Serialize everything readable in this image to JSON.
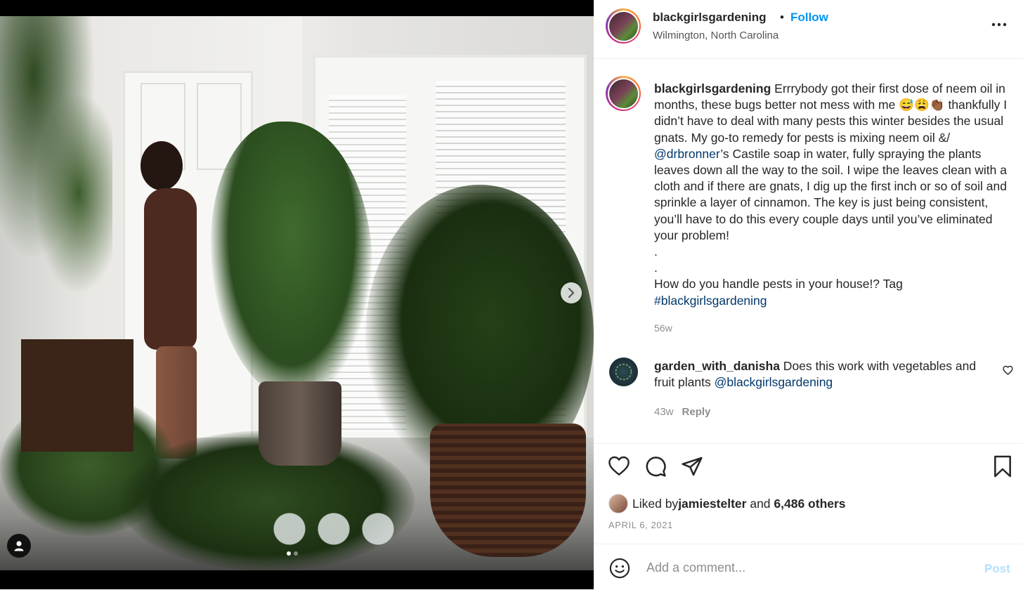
{
  "post": {
    "carousel": {
      "slide_count": 2,
      "active_slide": 1
    },
    "next_icon": "chevron-right-icon",
    "tagged_icon": "user-icon"
  },
  "header": {
    "username": "blackgirlsgardening",
    "separator": "•",
    "follow_label": "Follow",
    "location": "Wilmington, North Carolina",
    "more_icon": "more-horizontal-icon"
  },
  "caption": {
    "username": "blackgirlsgardening",
    "text_part1": " Errrybody got their first dose of neem oil in months, these bugs better not mess with me 😅😩👏🏾 thankfully I didn’t have to deal with many pests this winter besides the usual gnats. My go-to remedy for pests is mixing neem oil &/ ",
    "mention": "@drbronner",
    "text_part2": "’s Castile soap in water, fully spraying the plants leaves down all the way to the soil. I wipe the leaves clean with a cloth and if there are gnats, I dig up the first inch or so of soil and sprinkle a layer of cinnamon. The key is just being consistent, you’ll have to do this every couple days until you’ve eliminated your problem!",
    "dot1": ".",
    "dot2": ".",
    "question": "How do you handle pests in your house!? Tag",
    "hashtag": "#blackgirlsgardening",
    "time": "56w"
  },
  "comment": {
    "username": "garden_with_danisha",
    "text": " Does this work with vegetables and fruit plants ",
    "mention": "@blackgirlsgardening",
    "time": "43w",
    "reply_label": "Reply"
  },
  "actions": {
    "like_icon": "heart-icon",
    "comment_icon": "comment-icon",
    "share_icon": "send-icon",
    "save_icon": "bookmark-icon"
  },
  "likes": {
    "prefix": "Liked by ",
    "user": "jamiestelter",
    "middle": " and ",
    "others": "6,486 others"
  },
  "date": "APRIL 6, 2021",
  "add_comment": {
    "placeholder": "Add a comment...",
    "post_label": "Post",
    "emoji_icon": "smiley-icon"
  },
  "colors": {
    "accent": "#0095f6",
    "link": "#00376b",
    "muted": "#8e8e8e",
    "post_disabled": "#b2dffc"
  }
}
